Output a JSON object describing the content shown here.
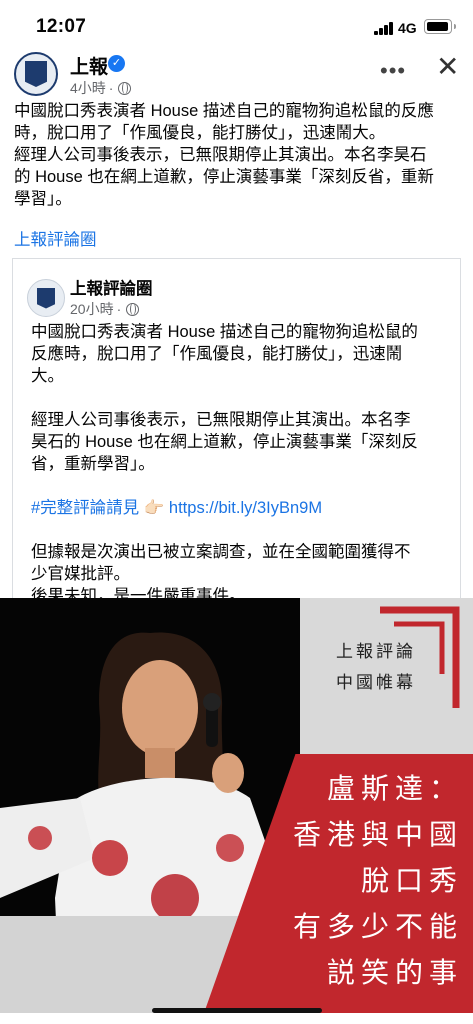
{
  "status_bar": {
    "time": "12:07",
    "network": "4G"
  },
  "post": {
    "page_name": "上報",
    "time": "4小時",
    "separator": "·",
    "more_icon": "more-icon",
    "close_icon": "close-icon",
    "text_lines": [
      "中國脫口秀表演者 House 描述自己的寵物狗追松鼠的反應",
      "時，脫口用了「作風優良，能打勝仗」，迅速鬧大。",
      "經理人公司事後表示，已無限期停止其演出。本名李昊石",
      "的 House 也在網上道歉，停止演藝事業「深刻反省，重新",
      "學習」。"
    ],
    "page_link": "上報評論圈"
  },
  "shared_post": {
    "page_name": "上報評論圈",
    "time": "20小時",
    "separator": "·",
    "para1": [
      "中國脫口秀表演者 House 描述自己的寵物狗追松鼠的",
      "反應時，脫口用了「作風優良，能打勝仗」，迅速鬧",
      "大。"
    ],
    "para2": [
      "經理人公司事後表示，已無限期停止其演出。本名李",
      "昊石的 House 也在網上道歉，停止演藝事業「深刻反",
      "省，重新學習」。"
    ],
    "hashtag": "#完整評論請見",
    "pointing_emoji": "👉🏻",
    "url": "https://bit.ly/3IyBn9M",
    "para3": [
      "但據報是次演出已被立案調查，並在全國範圍獲得不",
      "少官媒批評。",
      "後果未知，是一件嚴重事件。"
    ]
  },
  "image": {
    "label_lines": [
      "上報評論",
      "中國帷幕"
    ],
    "title_lines": [
      "盧斯達：",
      "香港與中國",
      "脫口秀",
      "有多少不能",
      "説笑的事"
    ],
    "accent_color": "#c1272d"
  }
}
